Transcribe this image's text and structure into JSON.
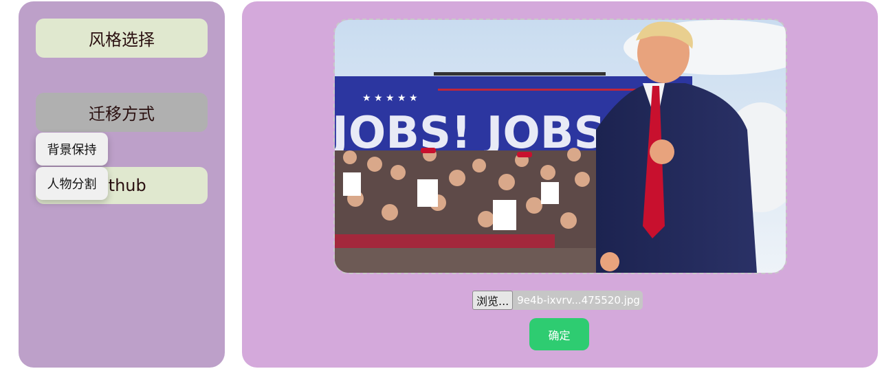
{
  "sidebar": {
    "style_select_label": "风格选择",
    "transfer_mode_label": "迁移方式",
    "github_label": "ithub",
    "dropdown": [
      "背景保持",
      "人物分割"
    ]
  },
  "photo": {
    "banner_text": "JOBS! JOBS!"
  },
  "upload": {
    "browse_label": "浏览...",
    "file_name": "9e4b-ixvrv...475520.jpg",
    "confirm_label": "确定"
  }
}
